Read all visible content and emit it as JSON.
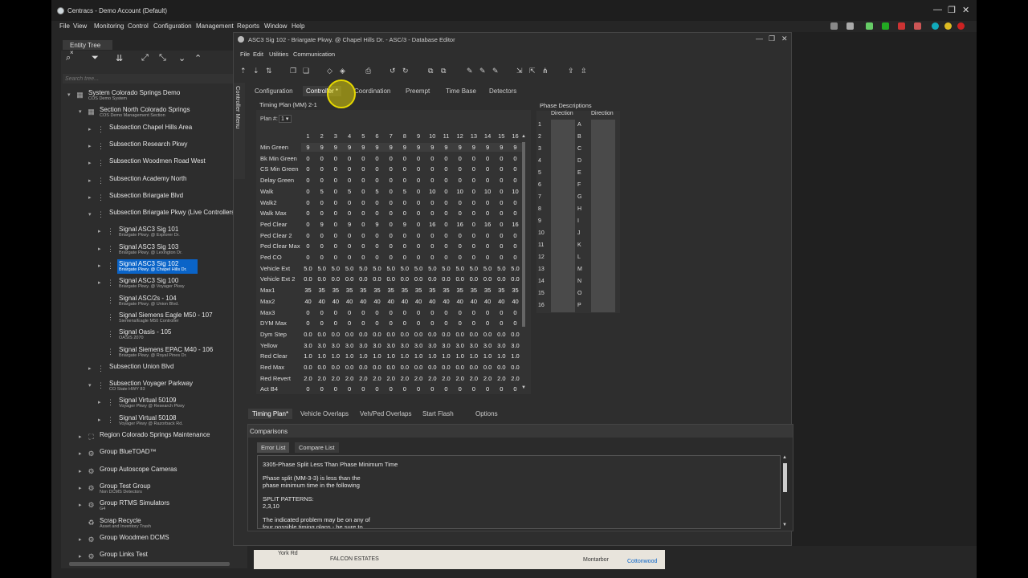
{
  "app": {
    "title": "Centracs - Demo Account (Default)",
    "menu": [
      "File",
      "View",
      "Monitoring",
      "Control",
      "Configuration",
      "Management",
      "Reports",
      "Window",
      "Help"
    ]
  },
  "entity_tree": {
    "tab_label": "Entity Tree",
    "close": "×",
    "search_placeholder": "Search tree...",
    "nodes": [
      {
        "label": "System  Colorado Springs Demo",
        "sub": "COS Demo System"
      },
      {
        "label": "Section  North Colorado Springs",
        "sub": "COS Demo Management Section"
      },
      {
        "label": "Subsection  Chapel Hills Area",
        "sub": ""
      },
      {
        "label": "Subsection  Research Pkwy",
        "sub": ""
      },
      {
        "label": "Subsection  Woodmen Road West",
        "sub": ""
      },
      {
        "label": "Subsection  Academy North",
        "sub": ""
      },
      {
        "label": "Subsection  Briargate Blvd",
        "sub": ""
      },
      {
        "label": "Subsection  Briargate Pkwy (Live Controllers)",
        "sub": ""
      },
      {
        "label": "Signal  ASC3 Sig 101",
        "sub": "Briargate Pkwy. @ Explorer Dr."
      },
      {
        "label": "Signal  ASC3 Sig 103",
        "sub": "Briargate Pkwy. @ Lexington Dr."
      },
      {
        "label": "Signal  ASC3 Sig 102",
        "sub": "Briargate Pkwy. @ Chapel Hills Dr."
      },
      {
        "label": "Signal  ASC3 Sig 100",
        "sub": "Briargate Pkwy. @ Voyager Pkwy"
      },
      {
        "label": "Signal  ASC/2s - 104",
        "sub": "Briargate Pkwy. @ Union Blvd."
      },
      {
        "label": "Signal  Siemens Eagle M50 - 107",
        "sub": "Siemens/Eagle M50 Controller"
      },
      {
        "label": "Signal  Oasis - 105",
        "sub": "OASIS 2070"
      },
      {
        "label": "Signal  Siemens EPAC M40 - 106",
        "sub": "Briargate Pkwy. @ Royal Pines Dr."
      },
      {
        "label": "Subsection  Union Blvd",
        "sub": ""
      },
      {
        "label": "Subsection  Voyager Parkway",
        "sub": "CO State HWY 83"
      },
      {
        "label": "Signal  Virtual 50109",
        "sub": "Voyager Pkwy @ Research Pkwy"
      },
      {
        "label": "Signal  Virtual 50108",
        "sub": "Voyager Pkwy @ Razorback Rd."
      },
      {
        "label": "Region  Colorado Springs Maintenance",
        "sub": ""
      },
      {
        "label": "Group  BlueTOAD™",
        "sub": ""
      },
      {
        "label": "Group  Autoscope Cameras",
        "sub": ""
      },
      {
        "label": "Group  Test Group",
        "sub": "Non DCMS Detectors"
      },
      {
        "label": "Group  RTMS Simulators",
        "sub": "G4"
      },
      {
        "label": "Scrap  Recycle",
        "sub": "Asset and Inventory Trash"
      },
      {
        "label": "Group  Woodmen DCMS",
        "sub": ""
      },
      {
        "label": "Group  Links Test",
        "sub": ""
      }
    ]
  },
  "db_editor": {
    "title": "ASC3 Sig 102 - Briargate Pkwy. @ Chapel Hills Dr. - ASC/3 - Database Editor",
    "menu": [
      "File",
      "Edit",
      "Utilities",
      "Communication"
    ],
    "side_menu": "Controller Menu",
    "tabs": [
      "Configuration",
      "Controller *",
      "Coordination",
      "Preempt",
      "Time Base",
      "Detectors"
    ],
    "timing_plan_label": "Timing Plan (MM) 2-1",
    "plan_label": "Plan #:",
    "plan_value": "1 ▾",
    "phases": [
      "1",
      "2",
      "3",
      "4",
      "5",
      "6",
      "7",
      "8",
      "9",
      "10",
      "11",
      "12",
      "13",
      "14",
      "15",
      "16"
    ],
    "rows": [
      {
        "name": "Min Green",
        "values": [
          "9",
          "9",
          "9",
          "9",
          "9",
          "9",
          "9",
          "9",
          "9",
          "9",
          "9",
          "9",
          "9",
          "9",
          "9",
          "9"
        ]
      },
      {
        "name": "Bk Min Green",
        "values": [
          "0",
          "0",
          "0",
          "0",
          "0",
          "0",
          "0",
          "0",
          "0",
          "0",
          "0",
          "0",
          "0",
          "0",
          "0",
          "0"
        ]
      },
      {
        "name": "CS Min Green",
        "values": [
          "0",
          "0",
          "0",
          "0",
          "0",
          "0",
          "0",
          "0",
          "0",
          "0",
          "0",
          "0",
          "0",
          "0",
          "0",
          "0"
        ]
      },
      {
        "name": "Delay Green",
        "values": [
          "0",
          "0",
          "0",
          "0",
          "0",
          "0",
          "0",
          "0",
          "0",
          "0",
          "0",
          "0",
          "0",
          "0",
          "0",
          "0"
        ]
      },
      {
        "name": "Walk",
        "values": [
          "0",
          "5",
          "0",
          "5",
          "0",
          "5",
          "0",
          "5",
          "0",
          "10",
          "0",
          "10",
          "0",
          "10",
          "0",
          "10"
        ]
      },
      {
        "name": "Walk2",
        "values": [
          "0",
          "0",
          "0",
          "0",
          "0",
          "0",
          "0",
          "0",
          "0",
          "0",
          "0",
          "0",
          "0",
          "0",
          "0",
          "0"
        ]
      },
      {
        "name": "Walk Max",
        "values": [
          "0",
          "0",
          "0",
          "0",
          "0",
          "0",
          "0",
          "0",
          "0",
          "0",
          "0",
          "0",
          "0",
          "0",
          "0",
          "0"
        ]
      },
      {
        "name": "Ped Clear",
        "values": [
          "0",
          "9",
          "0",
          "9",
          "0",
          "9",
          "0",
          "9",
          "0",
          "16",
          "0",
          "16",
          "0",
          "16",
          "0",
          "16"
        ]
      },
      {
        "name": "Ped Clear 2",
        "values": [
          "0",
          "0",
          "0",
          "0",
          "0",
          "0",
          "0",
          "0",
          "0",
          "0",
          "0",
          "0",
          "0",
          "0",
          "0",
          "0"
        ]
      },
      {
        "name": "Ped Clear Max",
        "values": [
          "0",
          "0",
          "0",
          "0",
          "0",
          "0",
          "0",
          "0",
          "0",
          "0",
          "0",
          "0",
          "0",
          "0",
          "0",
          "0"
        ]
      },
      {
        "name": "Ped CO",
        "values": [
          "0",
          "0",
          "0",
          "0",
          "0",
          "0",
          "0",
          "0",
          "0",
          "0",
          "0",
          "0",
          "0",
          "0",
          "0",
          "0"
        ]
      },
      {
        "name": "Vehicle Ext",
        "values": [
          "5.0",
          "5.0",
          "5.0",
          "5.0",
          "5.0",
          "5.0",
          "5.0",
          "5.0",
          "5.0",
          "5.0",
          "5.0",
          "5.0",
          "5.0",
          "5.0",
          "5.0",
          "5.0"
        ]
      },
      {
        "name": "Vehicle Ext 2",
        "values": [
          "0.0",
          "0.0",
          "0.0",
          "0.0",
          "0.0",
          "0.0",
          "0.0",
          "0.0",
          "0.0",
          "0.0",
          "0.0",
          "0.0",
          "0.0",
          "0.0",
          "0.0",
          "0.0"
        ]
      },
      {
        "name": "Max1",
        "values": [
          "35",
          "35",
          "35",
          "35",
          "35",
          "35",
          "35",
          "35",
          "35",
          "35",
          "35",
          "35",
          "35",
          "35",
          "35",
          "35"
        ]
      },
      {
        "name": "Max2",
        "values": [
          "40",
          "40",
          "40",
          "40",
          "40",
          "40",
          "40",
          "40",
          "40",
          "40",
          "40",
          "40",
          "40",
          "40",
          "40",
          "40"
        ]
      },
      {
        "name": "Max3",
        "values": [
          "0",
          "0",
          "0",
          "0",
          "0",
          "0",
          "0",
          "0",
          "0",
          "0",
          "0",
          "0",
          "0",
          "0",
          "0",
          "0"
        ]
      },
      {
        "name": "DYM Max",
        "values": [
          "0",
          "0",
          "0",
          "0",
          "0",
          "0",
          "0",
          "0",
          "0",
          "0",
          "0",
          "0",
          "0",
          "0",
          "0",
          "0"
        ]
      },
      {
        "name": "Dym Step",
        "values": [
          "0.0",
          "0.0",
          "0.0",
          "0.0",
          "0.0",
          "0.0",
          "0.0",
          "0.0",
          "0.0",
          "0.0",
          "0.0",
          "0.0",
          "0.0",
          "0.0",
          "0.0",
          "0.0"
        ]
      },
      {
        "name": "Yellow",
        "values": [
          "3.0",
          "3.0",
          "3.0",
          "3.0",
          "3.0",
          "3.0",
          "3.0",
          "3.0",
          "3.0",
          "3.0",
          "3.0",
          "3.0",
          "3.0",
          "3.0",
          "3.0",
          "3.0"
        ]
      },
      {
        "name": "Red Clear",
        "values": [
          "1.0",
          "1.0",
          "1.0",
          "1.0",
          "1.0",
          "1.0",
          "1.0",
          "1.0",
          "1.0",
          "1.0",
          "1.0",
          "1.0",
          "1.0",
          "1.0",
          "1.0",
          "1.0"
        ]
      },
      {
        "name": "Red Max",
        "values": [
          "0.0",
          "0.0",
          "0.0",
          "0.0",
          "0.0",
          "0.0",
          "0.0",
          "0.0",
          "0.0",
          "0.0",
          "0.0",
          "0.0",
          "0.0",
          "0.0",
          "0.0",
          "0.0"
        ]
      },
      {
        "name": "Red Revert",
        "values": [
          "2.0",
          "2.0",
          "2.0",
          "2.0",
          "2.0",
          "2.0",
          "2.0",
          "2.0",
          "2.0",
          "2.0",
          "2.0",
          "2.0",
          "2.0",
          "2.0",
          "2.0",
          "2.0"
        ]
      },
      {
        "name": "Act B4",
        "values": [
          "0",
          "0",
          "0",
          "0",
          "0",
          "0",
          "0",
          "0",
          "0",
          "0",
          "0",
          "0",
          "0",
          "0",
          "0",
          "0"
        ]
      }
    ],
    "phase_desc_label": "Phase Descriptions",
    "direction_label": "Direction",
    "phase_letters": [
      "A",
      "B",
      "C",
      "D",
      "E",
      "F",
      "G",
      "H",
      "I",
      "J",
      "K",
      "L",
      "M",
      "N",
      "O",
      "P"
    ],
    "bottom_tabs": [
      "Timing Plan*",
      "Vehicle Overlaps",
      "Veh/Ped Overlaps",
      "Start Flash",
      "Options"
    ]
  },
  "comparisons": {
    "title": "Comparisons",
    "tabs": [
      "Error List",
      "Compare List"
    ],
    "lines": [
      "3305-Phase Split Less Than Phase Minimum Time",
      "",
      "Phase split (MM-3-3) is less than the",
      "phase minimum time in the following",
      "",
      "SPLIT PATTERNS:",
      "2,3,10",
      "",
      "The indicated problem may be on any of",
      "four possible timing plans - be sure to"
    ]
  },
  "map": {
    "labels": [
      "York Rd",
      "FALCON ESTATES",
      "Montarbor",
      "Cottonwood"
    ]
  }
}
